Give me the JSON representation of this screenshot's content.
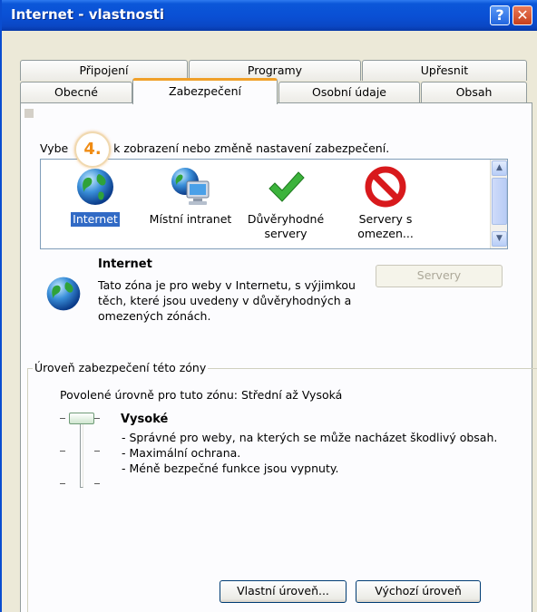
{
  "window": {
    "title": "Internet - vlastnosti"
  },
  "titlebar_buttons": {
    "help": "?",
    "close": "✕"
  },
  "tabs_row1": [
    "Připojení",
    "Programy",
    "Upřesnit"
  ],
  "tabs_row2": [
    "Obecné",
    "Zabezpečení",
    "Osobní údaje",
    "Obsah"
  ],
  "active_tab": "Zabezpečení",
  "instruction": {
    "before": "Vybe",
    "after": "u k zobrazení nebo změně nastavení zabezpečení."
  },
  "step_badge": "4.",
  "zones": [
    {
      "label": "Internet",
      "icon": "globe-icon",
      "selected": true
    },
    {
      "label": "Místní intranet",
      "icon": "computer-globe-icon",
      "selected": false
    },
    {
      "label": "Důvěryhodné servery",
      "icon": "checkmark-icon",
      "selected": false
    },
    {
      "label": "Servery s omezen...",
      "icon": "no-entry-icon",
      "selected": false
    }
  ],
  "zone_info": {
    "title": "Internet",
    "description": "Tato zóna je pro weby v Internetu, s výjimkou těch, které jsou uvedeny v důvěryhodných a omezených zónách.",
    "servers_button": "Servery"
  },
  "security_level": {
    "group_label": "Úroveň zabezpečení této zóny",
    "allowed": "Povolené úrovně pro tuto zónu: Střední až Vysoká",
    "level_name": "Vysoké",
    "bullets": [
      "- Správné pro weby, na kterých se může nacházet škodlivý obsah.",
      "- Maximální ochrana.",
      "- Méně bezpečné funkce jsou vypnuty."
    ],
    "slider_level": "Vysoké"
  },
  "buttons": {
    "custom_level": "Vlastní úroveň...",
    "default_level": "Výchozí úroveň"
  },
  "colors": {
    "titlebar": "#0a4fd4",
    "selection": "#316ac5",
    "active_tab_accent": "#f0a028",
    "badge": "#f08c14"
  }
}
